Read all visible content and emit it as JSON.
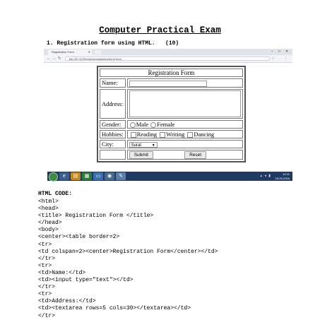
{
  "document": {
    "title": "Computer Practical Exam",
    "question": "1. Registration form using HTML.   (10)"
  },
  "browser": {
    "tab_title": "Registration Form",
    "url": "file:///E:/11/Revision/registration/form.html",
    "icons": {
      "back": "back-arrow-icon",
      "forward": "forward-arrow-icon",
      "reload": "reload-icon",
      "star": "bookmark-star-icon",
      "menu": "menu-dots-icon"
    }
  },
  "form": {
    "title": "Registration Form",
    "name_label": "Name:",
    "address_label": "Address:",
    "gender_label": "Gender:",
    "gender_options": [
      "Male",
      "Female"
    ],
    "hobbies_label": "Hobbies:",
    "hobby_options": [
      "Reading",
      "Writing",
      "Dancing"
    ],
    "city_label": "City:",
    "city_selected": "Surat",
    "submit_label": "Submit",
    "reset_label": "Reset"
  },
  "taskbar": {
    "time": "12:21",
    "date": "26-09-2016"
  },
  "code": {
    "heading": "HTML CODE:",
    "lines": [
      "<html>",
      "<head>",
      "<title> Registration Form </title>",
      "</head>",
      "<body>",
      "<center><table border=2>",
      "<tr>",
      "<td colspan=2><center>Registration Form</center></td>",
      "</tr>",
      "<tr>",
      "<td>Name:</td>",
      "<td><input type=\"text\"></td>",
      "</tr>",
      "<tr>",
      "<td>Address:</td>",
      "<td><textarea rows=5 cols=30></textarea></td>",
      "</tr>"
    ]
  },
  "colors": {
    "taskbar": "#1f3b63",
    "browser_chrome": "#dfe4ea"
  }
}
